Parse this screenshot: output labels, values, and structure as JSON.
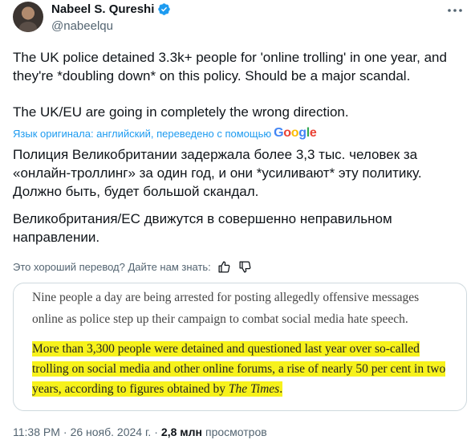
{
  "author": {
    "name": "Nabeel S. Qureshi",
    "handle": "@nabeelqu"
  },
  "tweet": {
    "original_p1": "The UK police detained 3.3k+ people for 'online trolling' in one year, and they're *doubling down* on this policy. Should be a major scandal.",
    "original_p2": "The UK/EU are going in completely the wrong direction.",
    "translation_note": "Язык оригинала: английский, переведено с помощью",
    "translation_service": "Google",
    "translated_p1": "Полиция Великобритании задержала более 3,3 тыс. человек за «онлайн-троллинг» за один год, и они *усиливают* эту политику. Должно быть, будет большой скандал.",
    "translated_p2": "Великобритания/ЕС движутся в совершенно неправильном направлении.",
    "feedback_prompt": "Это хороший перевод? Дайте нам знать:"
  },
  "image": {
    "lead": "Nine people a day are being arrested for posting allegedly offensive messages online as police step up their campaign to combat social media hate speech.",
    "highlight_main": "More than 3,300 people were detained and questioned last year over so-called trolling on social media and other online forums, a rise of nearly 50 per cent in two years, according to figures obtained by ",
    "highlight_source": "The Times",
    "highlight_end": "."
  },
  "meta": {
    "time": "11:38 PM",
    "date": "26 нояб. 2024 г.",
    "separator": "·",
    "views_count": "2,8 млн",
    "views_label": "просмотров"
  },
  "icons": {
    "verified": "verified-badge-icon",
    "more": "more-options-icon",
    "thumbs_up": "thumbs-up-icon",
    "thumbs_down": "thumbs-down-icon"
  },
  "colors": {
    "accent": "#1d9bf0",
    "secondary_text": "#536471",
    "highlight": "#f7f21c"
  }
}
